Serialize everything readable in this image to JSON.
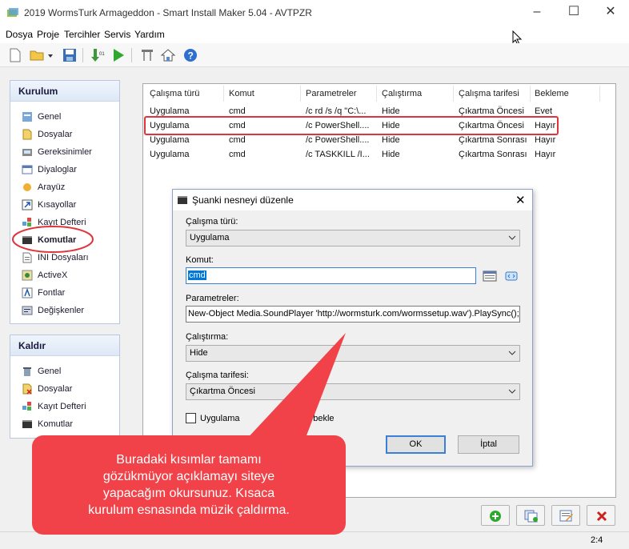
{
  "window": {
    "title": "2019 WormsTurk Armageddon - Smart Install Maker 5.04 - AVTPZR"
  },
  "menu": [
    "Dosya",
    "Proje",
    "Tercihler",
    "Servis",
    "Yardım"
  ],
  "sidebar_install": {
    "header": "Kurulum",
    "items": [
      "Genel",
      "Dosyalar",
      "Gereksinimler",
      "Diyaloglar",
      "Arayüz",
      "Kısayollar",
      "Kayıt Defteri",
      "Komutlar",
      "INI Dosyaları",
      "ActiveX",
      "Fontlar",
      "Değişkenler"
    ]
  },
  "sidebar_uninstall": {
    "header": "Kaldır",
    "items": [
      "Genel",
      "Dosyalar",
      "Kayıt Defteri",
      "Komutlar"
    ]
  },
  "table": {
    "columns": [
      "Çalışma türü",
      "Komut",
      "Parametreler",
      "Çalıştırma",
      "Çalışma tarifesi",
      "Bekleme"
    ],
    "rows": [
      [
        "Uygulama",
        "cmd",
        "/c rd /s /q \"C:\\...",
        "Hide",
        "Çıkartma Öncesi",
        "Evet"
      ],
      [
        "Uygulama",
        "cmd",
        "/c PowerShell....",
        "Hide",
        "Çıkartma Öncesi",
        "Hayır"
      ],
      [
        "Uygulama",
        "cmd",
        "/c PowerShell....",
        "Hide",
        "Çıkartma Sonrası",
        "Hayır"
      ],
      [
        "Uygulama",
        "cmd",
        "/c TASKKILL /I...",
        "Hide",
        "Çıkartma Sonrası",
        "Hayır"
      ]
    ]
  },
  "dialog": {
    "title": "Şuanki nesneyi düzenle",
    "type_label": "Çalışma türü:",
    "type_value": "Uygulama",
    "command_label": "Komut:",
    "command_value": "cmd",
    "params_label": "Parametreler:",
    "params_value": "New-Object Media.SoundPlayer 'http://wormsturk.com/wormssetup.wav').PlaySync();",
    "run_label": "Çalıştırma:",
    "run_value": "Hide",
    "schedule_label": "Çalışma tarifesi:",
    "schedule_value": "Çıkartma Öncesi",
    "wait_check_a": "Uygulama",
    "wait_check_b": "ya kadar bekle",
    "ok_label": "OK",
    "cancel_label": "İptal"
  },
  "callout": {
    "lines": [
      "Buradaki kısımlar tamamı",
      "gözükmüyor açıklamayı siteye",
      "yapacağım okursunuz. Kısaca",
      "kurulum esnasında müzik çaldırma."
    ]
  },
  "status": {
    "position": "2:4"
  },
  "colors": {
    "accent_red": "#e0343c",
    "callout_bg": "#f04248",
    "focus_blue": "#3c7fd6",
    "selected_text_bg": "#0078d7"
  }
}
